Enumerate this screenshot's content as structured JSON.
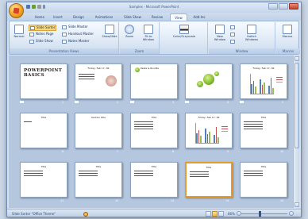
{
  "window": {
    "title": "Samples - Microsoft PowerPoint",
    "accent": "#f1b546"
  },
  "quick_access": [
    "save-icon",
    "undo-icon",
    "redo-icon",
    "customize-icon"
  ],
  "tabs": [
    {
      "label": "Home",
      "active": false
    },
    {
      "label": "Insert",
      "active": false
    },
    {
      "label": "Design",
      "active": false
    },
    {
      "label": "Animations",
      "active": false
    },
    {
      "label": "Slide Show",
      "active": false
    },
    {
      "label": "Review",
      "active": false
    },
    {
      "label": "View",
      "active": true
    },
    {
      "label": "Add-Ins",
      "active": false
    }
  ],
  "ribbon": {
    "presentation_views": {
      "label": "Presentation Views",
      "normal": "Normal",
      "slide_sorter": "Slide Sorter",
      "notes_page": "Notes Page",
      "slide_show": "Slide Show",
      "slide_master": "Slide Master",
      "handout_master": "Handout Master",
      "notes_master": "Notes Master",
      "show_hide": "Show/Hide"
    },
    "zoom": {
      "label": "Zoom",
      "zoom": "Zoom",
      "fit_to_window": "Fit to Window"
    },
    "color": {
      "label": "Color/Grayscale"
    },
    "window_group": {
      "label": "Window",
      "new_window": "New Window",
      "switch_windows": "Switch Windows"
    },
    "macros": {
      "label": "Macros",
      "macros": "Macros"
    }
  },
  "slides": [
    {
      "num": "1",
      "title": "POWERPOINT BASICS",
      "kind": "title"
    },
    {
      "num": "2",
      "title": "Friday, Feb 17, 06",
      "kind": "text-image"
    },
    {
      "num": "3",
      "title": "Pasta & Ricotta",
      "kind": "image"
    },
    {
      "num": "4",
      "title": "",
      "kind": "circles"
    },
    {
      "num": "5",
      "title": "Friday, Feb 17, 06",
      "kind": "chart"
    },
    {
      "num": "6",
      "title": "Title",
      "kind": "bullets-small"
    },
    {
      "num": "7",
      "title": "Section title",
      "kind": "blank"
    },
    {
      "num": "8",
      "title": "Title",
      "kind": "bullets"
    },
    {
      "num": "9",
      "title": "Friday, Feb 17, 06",
      "kind": "chart"
    },
    {
      "num": "10",
      "title": "Title",
      "kind": "bullets"
    },
    {
      "num": "11",
      "title": "Title",
      "kind": "bullets"
    },
    {
      "num": "12",
      "title": "Title",
      "kind": "bullets"
    },
    {
      "num": "13",
      "title": "Title",
      "kind": "bullets"
    },
    {
      "num": "14",
      "title": "Title",
      "kind": "bullets",
      "selected": true
    },
    {
      "num": "15",
      "title": "Title",
      "kind": "bullets"
    }
  ],
  "status": {
    "left": "Slide Sorter   \"Office Theme\"",
    "zoom": "66%"
  }
}
